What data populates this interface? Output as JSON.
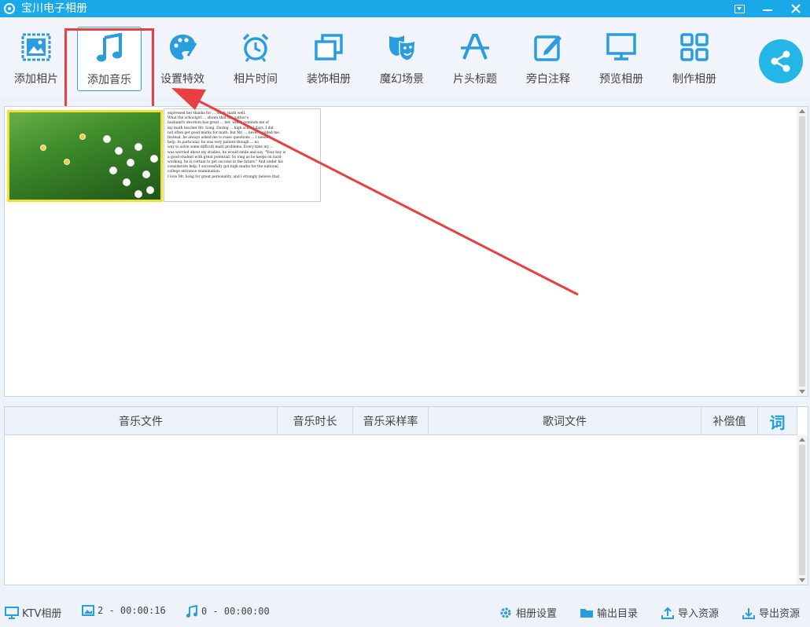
{
  "window": {
    "title": "宝川电子相册",
    "buttons": [
      "menu",
      "minimize",
      "close"
    ]
  },
  "toolbar": {
    "items": [
      {
        "label": "添加相片",
        "icon": "photo-icon"
      },
      {
        "label": "添加音乐",
        "icon": "music-note-icon",
        "active": true
      },
      {
        "label": "设置特效",
        "icon": "palette-icon"
      },
      {
        "label": "相片时间",
        "icon": "alarm-clock-icon"
      },
      {
        "label": "装饰相册",
        "icon": "stacked-frames-icon"
      },
      {
        "label": "魔幻场景",
        "icon": "theater-masks-icon"
      },
      {
        "label": "片头标题",
        "icon": "title-a-icon"
      },
      {
        "label": "旁白注释",
        "icon": "edit-note-icon"
      },
      {
        "label": "预览相册",
        "icon": "monitor-icon"
      },
      {
        "label": "制作相册",
        "icon": "grid-icon"
      }
    ],
    "share_icon": "share-icon"
  },
  "photos": {
    "text_thumb_lines": [
      "expressed her thanks for ... study math well.",
      "What the schoolgirl ... shows that the author's",
      "husband's devotion has great ... her, which reminds me of",
      "my math teacher Mr. Song. During ... high school days, I did",
      "not often get good marks for math, but Mr. ... never scolded me.",
      "Instead, he always asked me to raise questions ... I needed",
      "help. In particular, he was very patient though ... no",
      "way to solve some difficult math problems. Every time my ...",
      "was worried about my studies, he would smile and say, \"Your boy is",
      "a good student with great potential. So long as he keeps on hard-",
      "working, he is certain to get success in the future.\" And under his",
      "considerate help, I successfully got high marks for the national",
      "college entrance examination.",
      "I love Mr. Song for great personality, and I strongly believe that"
    ]
  },
  "music_table": {
    "columns": [
      "音乐文件",
      "音乐时长",
      "音乐采样率",
      "歌词文件",
      "补偿值",
      "词"
    ],
    "rows": []
  },
  "statusbar": {
    "mode_label": "KTV相册",
    "photo_count": "2 - 00:00:16",
    "music_count": "0 - 00:00:00",
    "album_settings": "相册设置",
    "output_dir": "输出目录",
    "import_res": "导入资源",
    "export_res": "导出资源"
  },
  "colors": {
    "titlebar": "#1aa8e8",
    "accent": "#1a9ee0",
    "annotation": "#e84040",
    "thumb_selected_border": "#f1e02d"
  }
}
